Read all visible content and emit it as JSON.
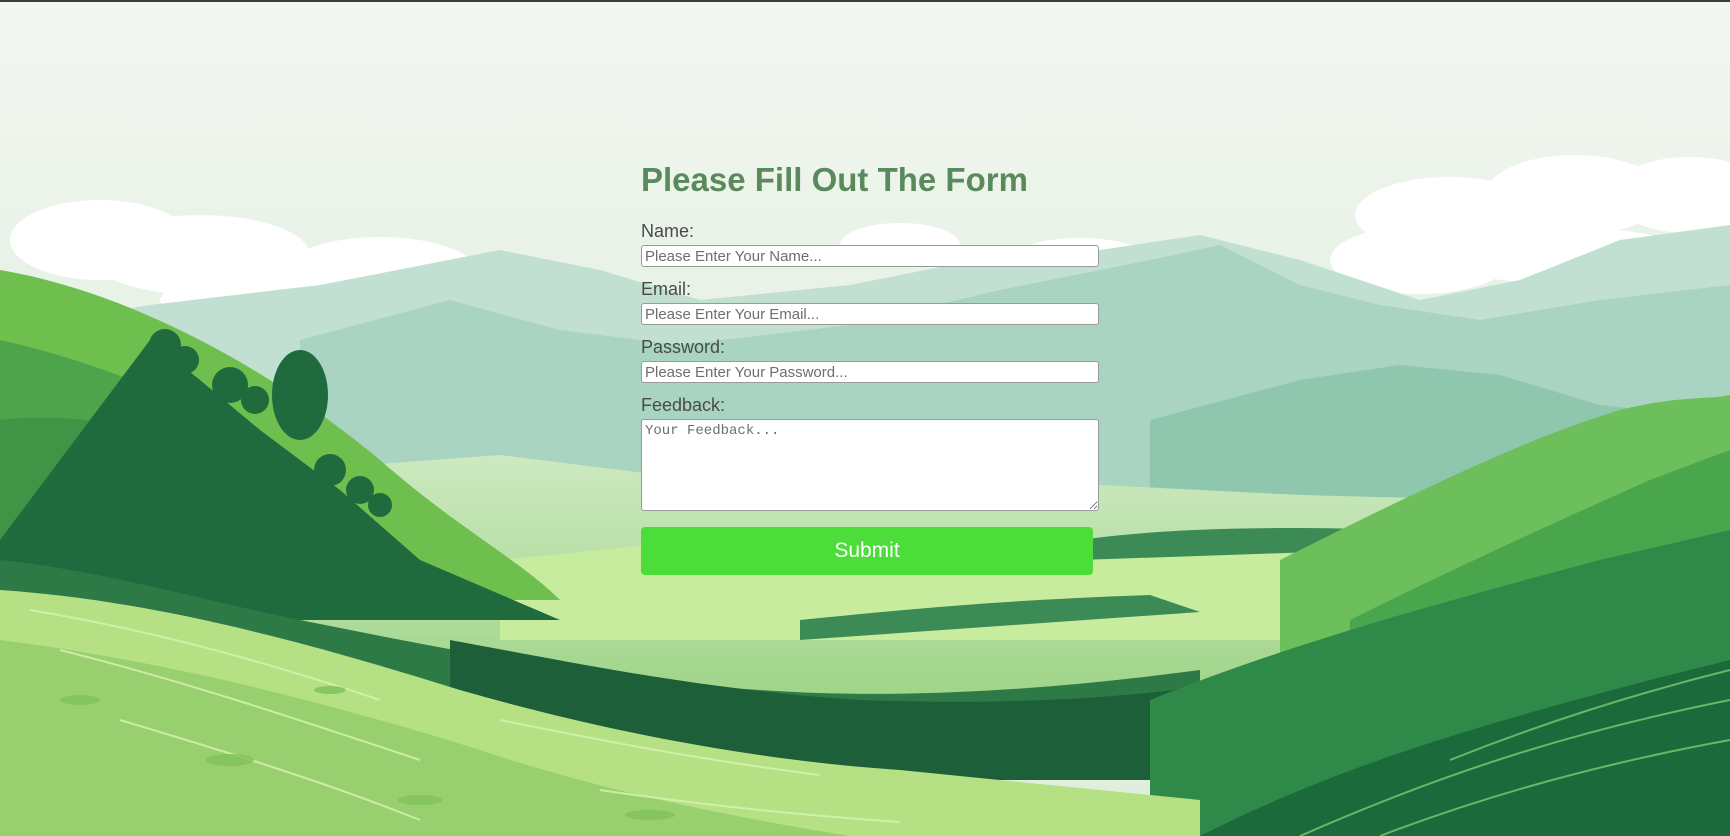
{
  "page": {
    "background_scene": "green-rolling-hills-illustration"
  },
  "form": {
    "title": "Please Fill Out The Form",
    "title_color": "#5a8a5c",
    "fields": {
      "name": {
        "label": "Name:",
        "placeholder": "Please Enter Your Name...",
        "value": ""
      },
      "email": {
        "label": "Email:",
        "placeholder": "Please Enter Your Email...",
        "value": ""
      },
      "password": {
        "label": "Password:",
        "placeholder": "Please Enter Your Password...",
        "value": ""
      },
      "feedback": {
        "label": "Feedback:",
        "placeholder": "Your Feedback...",
        "value": ""
      }
    },
    "submit": {
      "label": "Submit",
      "color": "#4cdd3a"
    }
  }
}
